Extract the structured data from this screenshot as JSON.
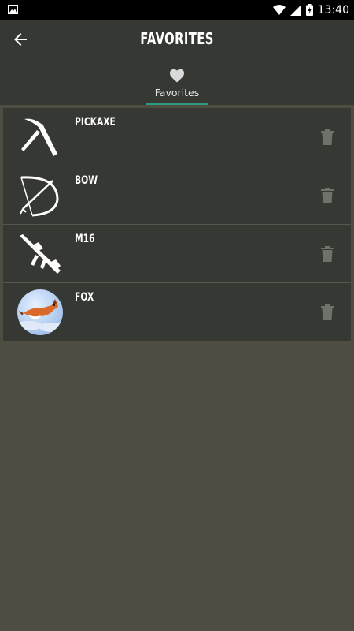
{
  "status_bar": {
    "time": "13:40",
    "icons": [
      "image-icon",
      "wifi-icon",
      "signal-icon",
      "battery-charging-icon"
    ]
  },
  "header": {
    "title": "FAVORITES",
    "back_icon": "arrow-back-icon"
  },
  "tabs": [
    {
      "label": "Favorites",
      "icon": "heart-icon",
      "selected": true
    }
  ],
  "colors": {
    "background": "#4e4d42",
    "app_bar": "#363833",
    "row": "#363833",
    "tab_indicator": "#2f9b82",
    "trash": "#6f716b"
  },
  "favorites": [
    {
      "name": "PICKAXE",
      "icon": "pickaxe-icon"
    },
    {
      "name": "BOW",
      "icon": "bow-icon"
    },
    {
      "name": "M16",
      "icon": "rifle-icon"
    },
    {
      "name": "FOX",
      "icon": "fox-avatar"
    }
  ]
}
